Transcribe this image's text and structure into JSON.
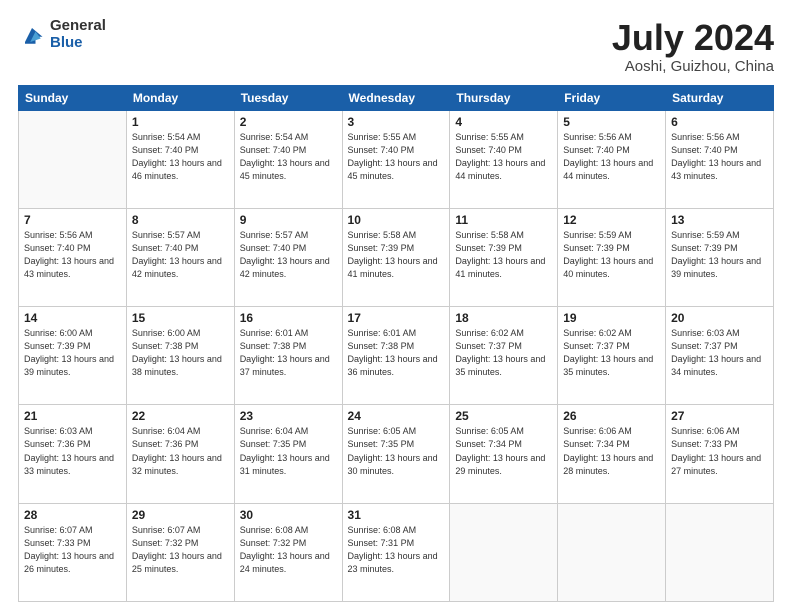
{
  "logo": {
    "general": "General",
    "blue": "Blue"
  },
  "title": {
    "month": "July 2024",
    "location": "Aoshi, Guizhou, China"
  },
  "days_header": [
    "Sunday",
    "Monday",
    "Tuesday",
    "Wednesday",
    "Thursday",
    "Friday",
    "Saturday"
  ],
  "weeks": [
    [
      {
        "day": "",
        "sunrise": "",
        "sunset": "",
        "daylight": ""
      },
      {
        "day": "1",
        "sunrise": "Sunrise: 5:54 AM",
        "sunset": "Sunset: 7:40 PM",
        "daylight": "Daylight: 13 hours and 46 minutes."
      },
      {
        "day": "2",
        "sunrise": "Sunrise: 5:54 AM",
        "sunset": "Sunset: 7:40 PM",
        "daylight": "Daylight: 13 hours and 45 minutes."
      },
      {
        "day": "3",
        "sunrise": "Sunrise: 5:55 AM",
        "sunset": "Sunset: 7:40 PM",
        "daylight": "Daylight: 13 hours and 45 minutes."
      },
      {
        "day": "4",
        "sunrise": "Sunrise: 5:55 AM",
        "sunset": "Sunset: 7:40 PM",
        "daylight": "Daylight: 13 hours and 44 minutes."
      },
      {
        "day": "5",
        "sunrise": "Sunrise: 5:56 AM",
        "sunset": "Sunset: 7:40 PM",
        "daylight": "Daylight: 13 hours and 44 minutes."
      },
      {
        "day": "6",
        "sunrise": "Sunrise: 5:56 AM",
        "sunset": "Sunset: 7:40 PM",
        "daylight": "Daylight: 13 hours and 43 minutes."
      }
    ],
    [
      {
        "day": "7",
        "sunrise": "Sunrise: 5:56 AM",
        "sunset": "Sunset: 7:40 PM",
        "daylight": "Daylight: 13 hours and 43 minutes."
      },
      {
        "day": "8",
        "sunrise": "Sunrise: 5:57 AM",
        "sunset": "Sunset: 7:40 PM",
        "daylight": "Daylight: 13 hours and 42 minutes."
      },
      {
        "day": "9",
        "sunrise": "Sunrise: 5:57 AM",
        "sunset": "Sunset: 7:40 PM",
        "daylight": "Daylight: 13 hours and 42 minutes."
      },
      {
        "day": "10",
        "sunrise": "Sunrise: 5:58 AM",
        "sunset": "Sunset: 7:39 PM",
        "daylight": "Daylight: 13 hours and 41 minutes."
      },
      {
        "day": "11",
        "sunrise": "Sunrise: 5:58 AM",
        "sunset": "Sunset: 7:39 PM",
        "daylight": "Daylight: 13 hours and 41 minutes."
      },
      {
        "day": "12",
        "sunrise": "Sunrise: 5:59 AM",
        "sunset": "Sunset: 7:39 PM",
        "daylight": "Daylight: 13 hours and 40 minutes."
      },
      {
        "day": "13",
        "sunrise": "Sunrise: 5:59 AM",
        "sunset": "Sunset: 7:39 PM",
        "daylight": "Daylight: 13 hours and 39 minutes."
      }
    ],
    [
      {
        "day": "14",
        "sunrise": "Sunrise: 6:00 AM",
        "sunset": "Sunset: 7:39 PM",
        "daylight": "Daylight: 13 hours and 39 minutes."
      },
      {
        "day": "15",
        "sunrise": "Sunrise: 6:00 AM",
        "sunset": "Sunset: 7:38 PM",
        "daylight": "Daylight: 13 hours and 38 minutes."
      },
      {
        "day": "16",
        "sunrise": "Sunrise: 6:01 AM",
        "sunset": "Sunset: 7:38 PM",
        "daylight": "Daylight: 13 hours and 37 minutes."
      },
      {
        "day": "17",
        "sunrise": "Sunrise: 6:01 AM",
        "sunset": "Sunset: 7:38 PM",
        "daylight": "Daylight: 13 hours and 36 minutes."
      },
      {
        "day": "18",
        "sunrise": "Sunrise: 6:02 AM",
        "sunset": "Sunset: 7:37 PM",
        "daylight": "Daylight: 13 hours and 35 minutes."
      },
      {
        "day": "19",
        "sunrise": "Sunrise: 6:02 AM",
        "sunset": "Sunset: 7:37 PM",
        "daylight": "Daylight: 13 hours and 35 minutes."
      },
      {
        "day": "20",
        "sunrise": "Sunrise: 6:03 AM",
        "sunset": "Sunset: 7:37 PM",
        "daylight": "Daylight: 13 hours and 34 minutes."
      }
    ],
    [
      {
        "day": "21",
        "sunrise": "Sunrise: 6:03 AM",
        "sunset": "Sunset: 7:36 PM",
        "daylight": "Daylight: 13 hours and 33 minutes."
      },
      {
        "day": "22",
        "sunrise": "Sunrise: 6:04 AM",
        "sunset": "Sunset: 7:36 PM",
        "daylight": "Daylight: 13 hours and 32 minutes."
      },
      {
        "day": "23",
        "sunrise": "Sunrise: 6:04 AM",
        "sunset": "Sunset: 7:35 PM",
        "daylight": "Daylight: 13 hours and 31 minutes."
      },
      {
        "day": "24",
        "sunrise": "Sunrise: 6:05 AM",
        "sunset": "Sunset: 7:35 PM",
        "daylight": "Daylight: 13 hours and 30 minutes."
      },
      {
        "day": "25",
        "sunrise": "Sunrise: 6:05 AM",
        "sunset": "Sunset: 7:34 PM",
        "daylight": "Daylight: 13 hours and 29 minutes."
      },
      {
        "day": "26",
        "sunrise": "Sunrise: 6:06 AM",
        "sunset": "Sunset: 7:34 PM",
        "daylight": "Daylight: 13 hours and 28 minutes."
      },
      {
        "day": "27",
        "sunrise": "Sunrise: 6:06 AM",
        "sunset": "Sunset: 7:33 PM",
        "daylight": "Daylight: 13 hours and 27 minutes."
      }
    ],
    [
      {
        "day": "28",
        "sunrise": "Sunrise: 6:07 AM",
        "sunset": "Sunset: 7:33 PM",
        "daylight": "Daylight: 13 hours and 26 minutes."
      },
      {
        "day": "29",
        "sunrise": "Sunrise: 6:07 AM",
        "sunset": "Sunset: 7:32 PM",
        "daylight": "Daylight: 13 hours and 25 minutes."
      },
      {
        "day": "30",
        "sunrise": "Sunrise: 6:08 AM",
        "sunset": "Sunset: 7:32 PM",
        "daylight": "Daylight: 13 hours and 24 minutes."
      },
      {
        "day": "31",
        "sunrise": "Sunrise: 6:08 AM",
        "sunset": "Sunset: 7:31 PM",
        "daylight": "Daylight: 13 hours and 23 minutes."
      },
      {
        "day": "",
        "sunrise": "",
        "sunset": "",
        "daylight": ""
      },
      {
        "day": "",
        "sunrise": "",
        "sunset": "",
        "daylight": ""
      },
      {
        "day": "",
        "sunrise": "",
        "sunset": "",
        "daylight": ""
      }
    ]
  ]
}
